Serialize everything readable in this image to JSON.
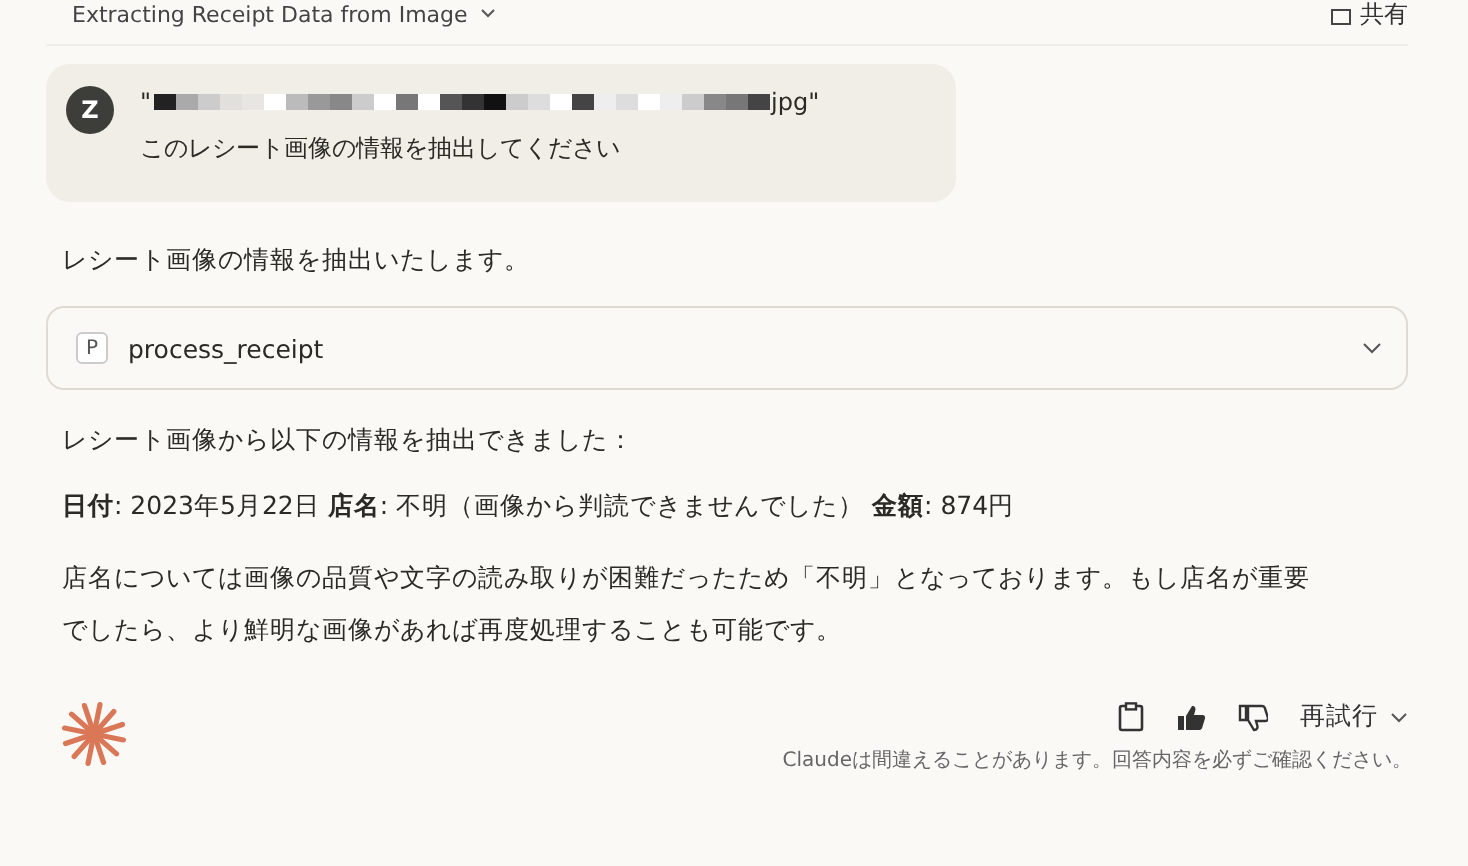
{
  "header": {
    "title": "Extracting Receipt Data from Image",
    "share": "共有"
  },
  "user_message": {
    "avatar": "Z",
    "file_open": "\"",
    "file_close": "jpg\"",
    "text": "このレシート画像の情報を抽出してください"
  },
  "assistant": {
    "intro": "レシート画像の情報を抽出いたします。",
    "tool": {
      "badge": "P",
      "name": "process_receipt",
      "expanded": false
    },
    "result_intro": "レシート画像から以下の情報を抽出できました：",
    "fields_line": "**日付**: 2023年5月22日 **店名**: 不明（画像から判読できませんでした） **金額**: 874円",
    "note": "店名については画像の品質や文字の読み取りが困難だったため「不明」となっております。もし店名が重要でしたら、より鮮明な画像があれば再度処理することも可能です。"
  },
  "footer": {
    "retry": "再試行",
    "disclaimer": "Claudeは間違えることがあります。回答内容を必ずご確認ください。"
  }
}
